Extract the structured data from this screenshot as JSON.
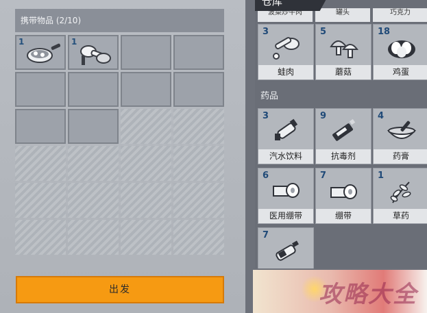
{
  "carry": {
    "header": "携带物品 (2/10)",
    "slots": [
      {
        "qty": "1",
        "icon": "frying-pan-icon"
      },
      {
        "qty": "1",
        "icon": "frog-legs-icon"
      }
    ],
    "depart_label": "出发"
  },
  "warehouse": {
    "title": "仓库",
    "top_partial_labels": [
      "波菜炒牛肉",
      "罐头",
      "巧克力"
    ],
    "food_items": [
      {
        "qty": "3",
        "name": "蛙肉",
        "icon": "frog-meat-icon"
      },
      {
        "qty": "5",
        "name": "蘑菇",
        "icon": "mushroom-icon"
      },
      {
        "qty": "18",
        "name": "鸡蛋",
        "icon": "egg-icon"
      }
    ],
    "medicine_section": "药品",
    "medicine_items": [
      {
        "qty": "3",
        "name": "汽水饮料",
        "icon": "soda-bottle-icon"
      },
      {
        "qty": "9",
        "name": "抗毒剂",
        "icon": "antidote-icon"
      },
      {
        "qty": "4",
        "name": "药膏",
        "icon": "ointment-bowl-icon"
      },
      {
        "qty": "6",
        "name": "医用绷带",
        "icon": "medical-bandage-icon"
      },
      {
        "qty": "7",
        "name": "绷带",
        "icon": "bandage-icon"
      },
      {
        "qty": "1",
        "name": "草药",
        "icon": "herb-icon"
      },
      {
        "qty": "7",
        "name": "",
        "icon": "beer-bottle-icon"
      }
    ]
  },
  "watermark": "攻略大全",
  "colors": {
    "accent_button": "#f69a12",
    "qty_blue": "#204a78",
    "panel_dark": "#6a6e77"
  }
}
